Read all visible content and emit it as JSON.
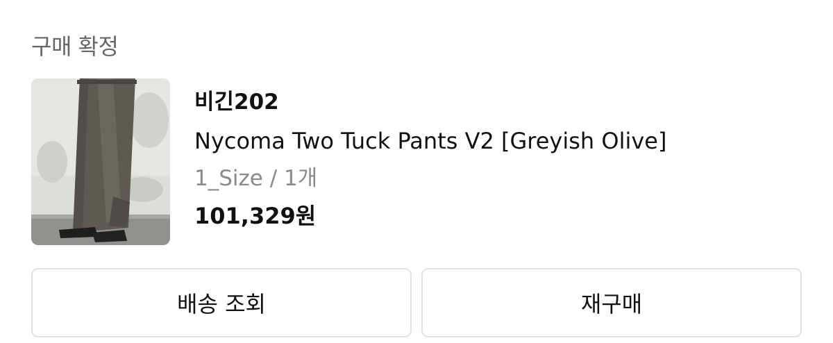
{
  "order": {
    "status": "구매 확정",
    "product": {
      "brand": "비긴202",
      "name": "Nycoma Two Tuck Pants V2 [Greyish Olive]",
      "option": "1_Size / 1개",
      "price": "101,329원",
      "image": "product-photo-wide-pants"
    },
    "actions": {
      "shipping_label": "배송 조회",
      "reorder_label": "재구매"
    }
  }
}
